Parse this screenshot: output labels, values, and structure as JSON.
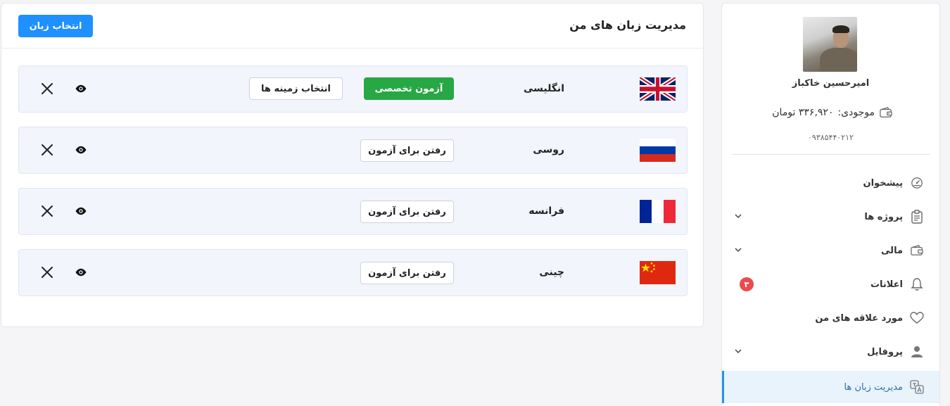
{
  "colors": {
    "primary": "#1e90ff",
    "success": "#28a745",
    "badge": "#e84c4c",
    "active_bg": "#e8f3fb",
    "active_border": "#2196f3"
  },
  "main": {
    "title": "مدیریت زبان های من",
    "select_language_button": "انتخاب زبان",
    "languages": [
      {
        "name": "انگلیسی",
        "flag": "uk-flag",
        "primary_action": "آزمون تخصصی",
        "secondary_action": "انتخاب زمینه ها"
      },
      {
        "name": "روسی",
        "flag": "russia-flag",
        "primary_action": "رفتن برای آزمون"
      },
      {
        "name": "فرانسه",
        "flag": "france-flag",
        "primary_action": "رفتن برای آزمون"
      },
      {
        "name": "چینی",
        "flag": "china-flag",
        "primary_action": "رفتن برای آزمون"
      }
    ]
  },
  "sidebar": {
    "user_name": "امیرحسین خاکباز",
    "balance_label": "موجودی:",
    "balance_value": "۳۳۶,۹۲۰ تومان",
    "phone": "۰۹۳۸۵۴۴۰۲۱۲",
    "menu": [
      {
        "label": "پیشخوان",
        "icon": "dashboard-icon"
      },
      {
        "label": "پروژه ها",
        "icon": "clipboard-icon",
        "expandable": true
      },
      {
        "label": "مالی",
        "icon": "wallet-icon",
        "expandable": true
      },
      {
        "label": "اعلانات",
        "icon": "bell-icon",
        "badge": "۳"
      },
      {
        "label": "مورد علاقه های من",
        "icon": "heart-icon"
      },
      {
        "label": "پروفایل",
        "icon": "user-icon",
        "expandable": true
      },
      {
        "label": "مدیریت زبان ها",
        "icon": "translate-icon",
        "active": true
      }
    ]
  }
}
